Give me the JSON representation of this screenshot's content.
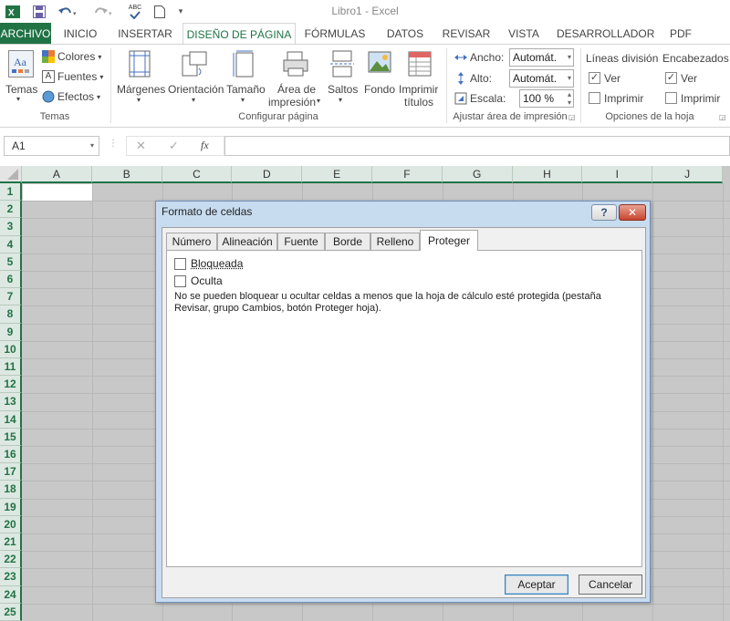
{
  "window": {
    "title": "Libro1 - Excel"
  },
  "quick_access": {
    "excel_icon": "excel-icon",
    "save_icon": "save-icon",
    "undo_icon": "undo-icon",
    "redo_icon": "redo-icon",
    "spell_icon": "spell-check-icon",
    "spell_label": "ABC",
    "new_icon": "new-doc-icon"
  },
  "tabs": [
    {
      "label": "ARCHIVO"
    },
    {
      "label": "INICIO"
    },
    {
      "label": "INSERTAR"
    },
    {
      "label": "DISEÑO DE PÁGINA"
    },
    {
      "label": "FÓRMULAS"
    },
    {
      "label": "DATOS"
    },
    {
      "label": "REVISAR"
    },
    {
      "label": "VISTA"
    },
    {
      "label": "DESARROLLADOR"
    },
    {
      "label": "PDF"
    }
  ],
  "ribbon": {
    "temas": {
      "button": "Temas",
      "colores": "Colores",
      "fuentes": "Fuentes",
      "efectos": "Efectos",
      "group": "Temas"
    },
    "configurar": {
      "margenes": "Márgenes",
      "orientacion": "Orientación",
      "tamano": "Tamaño",
      "area_l1": "Área de",
      "area_l2": "impresión",
      "saltos": "Saltos",
      "fondo": "Fondo",
      "imprimir_l1": "Imprimir",
      "imprimir_l2": "títulos",
      "group": "Configurar página"
    },
    "ajustar": {
      "ancho_label": "Ancho:",
      "ancho_value": "Automát.",
      "alto_label": "Alto:",
      "alto_value": "Automát.",
      "escala_label": "Escala:",
      "escala_value": "100 %",
      "group": "Ajustar área de impresión"
    },
    "opciones": {
      "lineas": "Líneas división",
      "encabezados": "Encabezados",
      "ver": "Ver",
      "imprimir": "Imprimir",
      "group": "Opciones de la hoja"
    }
  },
  "formula_bar": {
    "name_box": "A1",
    "cancel": "✕",
    "enter": "✓",
    "fx": "fx",
    "value": ""
  },
  "grid": {
    "columns": [
      "A",
      "B",
      "C",
      "D",
      "E",
      "F",
      "G",
      "H",
      "I",
      "J"
    ],
    "rows": [
      "1",
      "2",
      "3",
      "4",
      "5",
      "6",
      "7",
      "8",
      "9",
      "10",
      "11",
      "12",
      "13",
      "14",
      "15",
      "16",
      "17",
      "18",
      "19",
      "20",
      "21",
      "22",
      "23",
      "24",
      "25"
    ]
  },
  "dialog": {
    "title": "Formato de celdas",
    "help": "?",
    "close": "✕",
    "tabs": [
      {
        "label": "Número"
      },
      {
        "label": "Alineación"
      },
      {
        "label": "Fuente"
      },
      {
        "label": "Borde"
      },
      {
        "label": "Relleno"
      },
      {
        "label": "Proteger"
      }
    ],
    "bloqueada": "Bloqueada",
    "oculta": "Oculta",
    "info_l1": "No se pueden bloquear u ocultar celdas a menos que la hoja de cálculo esté protegida (pestaña",
    "info_l2": "Revisar, grupo Cambios, botón Proteger hoja).",
    "ok": "Aceptar",
    "cancel": "Cancelar"
  },
  "colors": {
    "accent": "#217346",
    "dialog_frame": "#c8dcf0"
  }
}
